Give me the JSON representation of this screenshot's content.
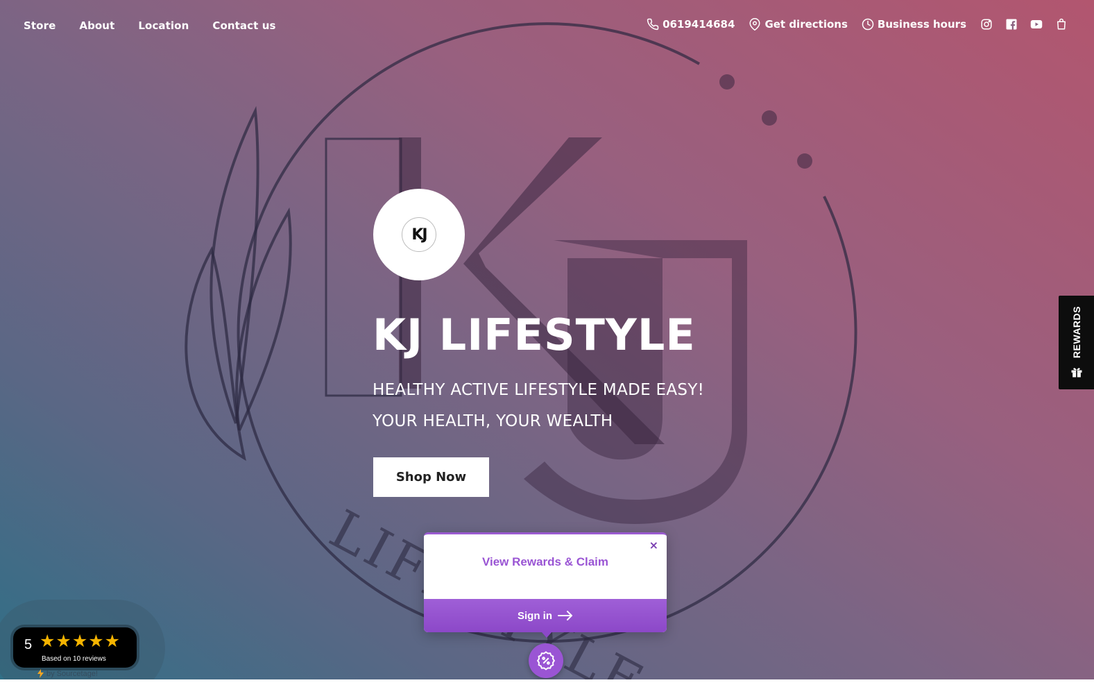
{
  "nav": {
    "left": [
      "Store",
      "About",
      "Location",
      "Contact us"
    ],
    "phone": "0619414684",
    "directions": "Get directions",
    "hours": "Business hours",
    "icons": [
      "instagram-icon",
      "facebook-icon",
      "youtube-icon",
      "shopping-bag-icon"
    ]
  },
  "hero": {
    "logo_text": "KJ",
    "title": "KJ LIFESTYLE",
    "subtitle_line1": "HEALTHY ACTIVE LIFESTYLE MADE EASY!",
    "subtitle_line2": "YOUR HEALTH, YOUR WEALTH",
    "cta": "Shop Now",
    "background_art_text": "KJ",
    "background_art_lettering": "LIFESTYLE"
  },
  "rewards_tab": {
    "label": "REWARDS"
  },
  "rewards_popup": {
    "title": "View Rewards & Claim",
    "close": "×",
    "signin": "Sign in"
  },
  "reviews": {
    "score": "5",
    "stars": "★★★★★",
    "summary": "Based on 10 reviews",
    "powered_by": "by Sourcetage!"
  },
  "colors": {
    "accent": "#9a55d4",
    "gradient_left": "#2f6f86",
    "gradient_right": "#b2566f",
    "star": "#f5b400"
  }
}
